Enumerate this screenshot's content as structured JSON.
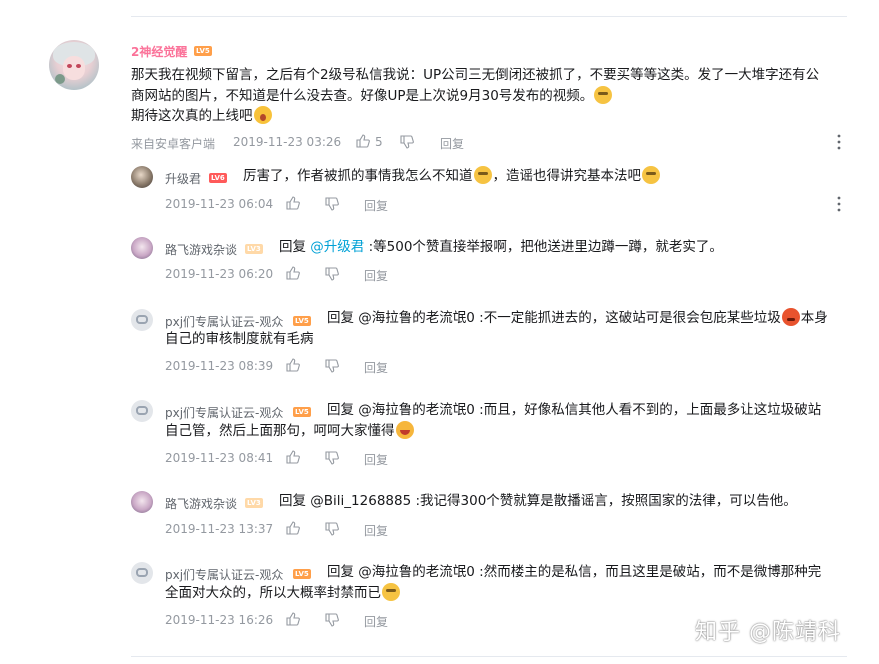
{
  "main_comment": {
    "username": "2神经觉醒",
    "level": "LV5",
    "text_line1": "那天我在视频下留言，之后有个2级号私信我说：UP公司三无倒闭还被抓了，不要买等等这类。发了一大堆字还有公",
    "text_line2": "商网站的图片，不知道是什么没去查。好像UP是上次说9月30号发布的视频。",
    "text_line3": "期待这次真的上线吧",
    "source": "来自安卓客户端",
    "time": "2019-11-23 03:26",
    "likes": "5",
    "reply_label": "回复"
  },
  "replies": [
    {
      "username": "升级君",
      "level": "LV6",
      "text_a": "厉害了，作者被抓的事情我怎么不知道",
      "text_b": "，造谣也得讲究基本法吧",
      "time": "2019-11-23 06:04",
      "reply_label": "回复"
    },
    {
      "username": "路飞游戏杂谈",
      "level": "LV3",
      "prefix": "回复 ",
      "mention": "@升级君",
      "text_a": " :等500个赞直接举报啊，把他送进里边蹲一蹲，就老实了。",
      "time": "2019-11-23 06:20",
      "reply_label": "回复"
    },
    {
      "username": "pxj们专属认证云-观众",
      "level": "LV5",
      "text_a": "回复 @海拉鲁的老流氓0 :不一定能抓进去的，这破站可是很会包庇某些垃圾",
      "text_b": "本身",
      "text_c": "自己的审核制度就有毛病",
      "time": "2019-11-23 08:39",
      "reply_label": "回复"
    },
    {
      "username": "pxj们专属认证云-观众",
      "level": "LV5",
      "text_a": "回复 @海拉鲁的老流氓0 :而且，好像私信其他人看不到的，上面最多让这垃圾破站",
      "text_c": "自己管，然后上面那句，呵呵大家懂得",
      "time": "2019-11-23 08:41",
      "reply_label": "回复"
    },
    {
      "username": "路飞游戏杂谈",
      "level": "LV3",
      "text_a": "回复 @Bili_1268885 :我记得300个赞就算是散播谣言，按照国家的法律，可以告他。",
      "time": "2019-11-23 13:37",
      "reply_label": "回复"
    },
    {
      "username": "pxj们专属认证云-观众",
      "level": "LV5",
      "text_a": "回复 @海拉鲁的老流氓0 :然而楼主的是私信，而且这里是破站，而不是微博那种完",
      "text_c": "全面对大众的，所以大概率封禁而已",
      "time": "2019-11-23 16:26",
      "reply_label": "回复"
    }
  ],
  "watermark": "知乎 @陈靖科",
  "colors": {
    "vip_name": "#fb7299",
    "mention": "#00a1d6",
    "meta": "#9499a0"
  }
}
